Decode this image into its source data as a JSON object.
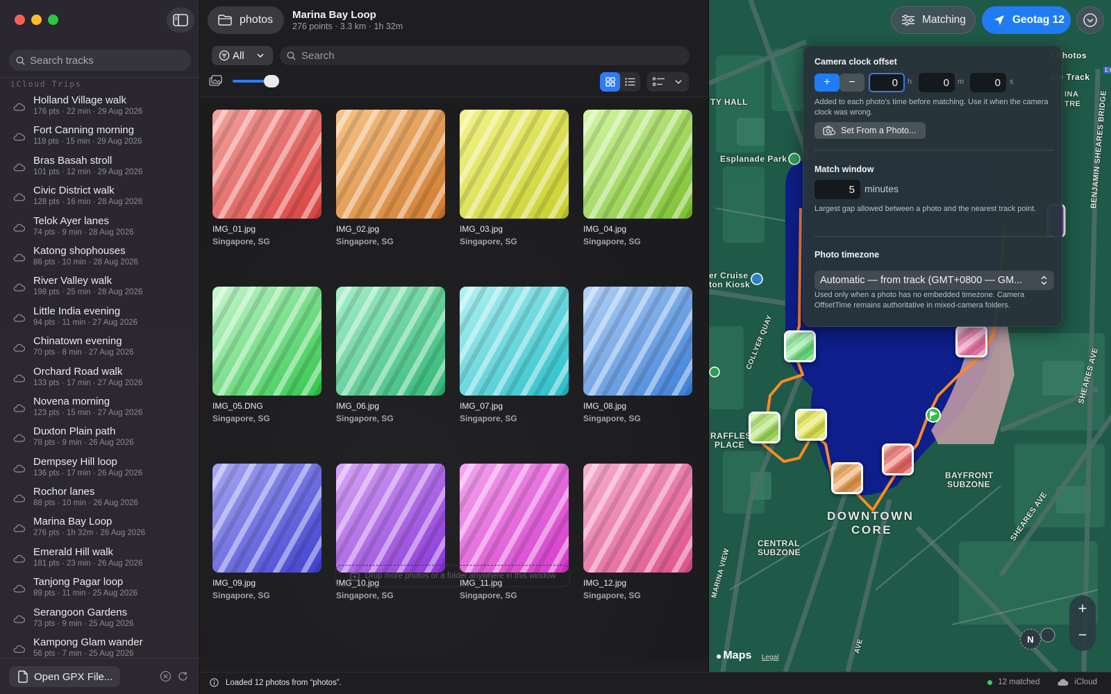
{
  "sidebar": {
    "search_placeholder": "Search tracks",
    "section_title": "iCloud Trips",
    "tracks": [
      {
        "title": "Holland Village walk",
        "meta": "176 pts · 22 min · 29 Aug 2026"
      },
      {
        "title": "Fort Canning morning",
        "meta": "118 pts · 15 min · 29 Aug 2026"
      },
      {
        "title": "Bras Basah stroll",
        "meta": "101 pts · 12 min · 29 Aug 2026"
      },
      {
        "title": "Civic District walk",
        "meta": "128 pts · 16 min · 28 Aug 2026"
      },
      {
        "title": "Telok Ayer lanes",
        "meta": "74 pts · 9 min · 28 Aug 2026"
      },
      {
        "title": "Katong shophouses",
        "meta": "86 pts · 10 min · 28 Aug 2026"
      },
      {
        "title": "River Valley walk",
        "meta": "198 pts · 25 min · 28 Aug 2026"
      },
      {
        "title": "Little India evening",
        "meta": "94 pts · 11 min · 27 Aug 2026"
      },
      {
        "title": "Chinatown evening",
        "meta": "70 pts · 8 min · 27 Aug 2026"
      },
      {
        "title": "Orchard Road walk",
        "meta": "133 pts · 17 min · 27 Aug 2026"
      },
      {
        "title": "Novena morning",
        "meta": "123 pts · 15 min · 27 Aug 2026"
      },
      {
        "title": "Duxton Plain path",
        "meta": "78 pts · 9 min · 26 Aug 2026"
      },
      {
        "title": "Dempsey Hill loop",
        "meta": "136 pts · 17 min · 26 Aug 2026"
      },
      {
        "title": "Rochor lanes",
        "meta": "88 pts · 10 min · 26 Aug 2026"
      },
      {
        "title": "Marina Bay Loop",
        "meta": "276 pts · 1h 32m · 26 Aug 2026"
      },
      {
        "title": "Emerald Hill walk",
        "meta": "181 pts · 23 min · 26 Aug 2026"
      },
      {
        "title": "Tanjong Pagar loop",
        "meta": "89 pts · 11 min · 25 Aug 2026"
      },
      {
        "title": "Serangoon Gardens",
        "meta": "73 pts · 9 min · 25 Aug 2026"
      },
      {
        "title": "Kampong Glam wander",
        "meta": "56 pts · 7 min · 25 Aug 2026"
      }
    ],
    "open_button": "Open GPX File..."
  },
  "header": {
    "folder_label": "photos",
    "trip_title": "Marina Bay Loop",
    "trip_subtitle": "276 points · 3.3 km · 1h 32m"
  },
  "filter": {
    "selected": "All",
    "search_placeholder": "Search"
  },
  "thumbnail_size": 0.85,
  "photos": [
    {
      "name": "IMG_01.jpg",
      "location": "Singapore, SG",
      "colors": [
        "#f3a4a0",
        "#d8403d"
      ]
    },
    {
      "name": "IMG_02.jpg",
      "location": "Singapore, SG",
      "colors": [
        "#f7c58a",
        "#d07a2c"
      ]
    },
    {
      "name": "IMG_03.jpg",
      "location": "Singapore, SG",
      "colors": [
        "#f4f48c",
        "#c7cf2a"
      ]
    },
    {
      "name": "IMG_04.jpg",
      "location": "Singapore, SG",
      "colors": [
        "#d6f7a8",
        "#79c02c"
      ]
    },
    {
      "name": "IMG_05.DNG",
      "location": "Singapore, SG",
      "colors": [
        "#c8f8d0",
        "#2fc74a"
      ]
    },
    {
      "name": "IMG_06.jpg",
      "location": "Singapore, SG",
      "colors": [
        "#a8f0cc",
        "#2fb674"
      ]
    },
    {
      "name": "IMG_07.jpg",
      "location": "Singapore, SG",
      "colors": [
        "#b4f2f2",
        "#25bec9"
      ]
    },
    {
      "name": "IMG_08.jpg",
      "location": "Singapore, SG",
      "colors": [
        "#b4d2f7",
        "#3b7fd6"
      ]
    },
    {
      "name": "IMG_09.jpg",
      "location": "Singapore, SG",
      "colors": [
        "#a9a8f4",
        "#3d3fcf"
      ]
    },
    {
      "name": "IMG_10.jpg",
      "location": "Singapore, SG",
      "colors": [
        "#d8a8f6",
        "#8a35d7"
      ]
    },
    {
      "name": "IMG_11.jpg",
      "location": "Singapore, SG",
      "colors": [
        "#f4a8f0",
        "#d536c9"
      ]
    },
    {
      "name": "IMG_12.jpg",
      "location": "Singapore, SG",
      "colors": [
        "#f7b0cf",
        "#dd4f8a"
      ]
    }
  ],
  "dropzone": "Drop more photos or a folder anywhere in this window",
  "map": {
    "matching_label": "Matching",
    "geotag_label": "Geotag 12",
    "labels": {
      "city_hall": "TY HALL",
      "esplanade": "Esplanade Park",
      "cruise_1": "er Cruise",
      "cruise_2": "ton Kiosk",
      "collyer": "COLLYER QUAY",
      "raffles_1": "RAFFLES",
      "raffles_2": "PLACE",
      "downtown_1": "DOWNTOWN",
      "downtown_2": "CORE",
      "central_1": "CENTRAL",
      "central_2": "SUBZONE",
      "bayfront_1": "BAYFRONT",
      "bayfront_2": "SUBZONE",
      "benjamin": "BENJAMIN SHEARES BRIDGE",
      "shears_ave_1": "SHEARES AVE",
      "shears_ave_2": "SHEARES AVE",
      "marina_view": "MARINA VIEW",
      "ave": "AVE",
      "ina": "INA",
      "tre": "TRE",
      "photos_tab": "t Photos",
      "track_tab": "ole Track",
      "ecp": "ECP",
      "compass": "N",
      "maps_brand": "Maps",
      "legal": "Legal"
    }
  },
  "popover": {
    "clock_title": "Camera clock offset",
    "plus": "+",
    "minus": "−",
    "hours": "0",
    "minutes": "0",
    "seconds": "0",
    "unit_h": "h",
    "unit_m": "m",
    "unit_s": "s",
    "clock_help": "Added to each photo's time before matching. Use it when the camera clock was wrong.",
    "set_from_photo": "Set From a Photo...",
    "window_title": "Match window",
    "window_value": "5",
    "window_unit": "minutes",
    "window_help": "Largest gap allowed between a photo and the nearest track point.",
    "tz_title": "Photo timezone",
    "tz_value": "Automatic — from track (GMT+0800 — GM...",
    "tz_help": "Used only when a photo has no embedded timezone. Camera OffsetTime remains authoritative in mixed-camera folders."
  },
  "status": {
    "message": "Loaded 12 photos from “photos”.",
    "matched": "12 matched",
    "cloud": "iCloud"
  },
  "zoom": {
    "in": "+",
    "out": "−"
  }
}
